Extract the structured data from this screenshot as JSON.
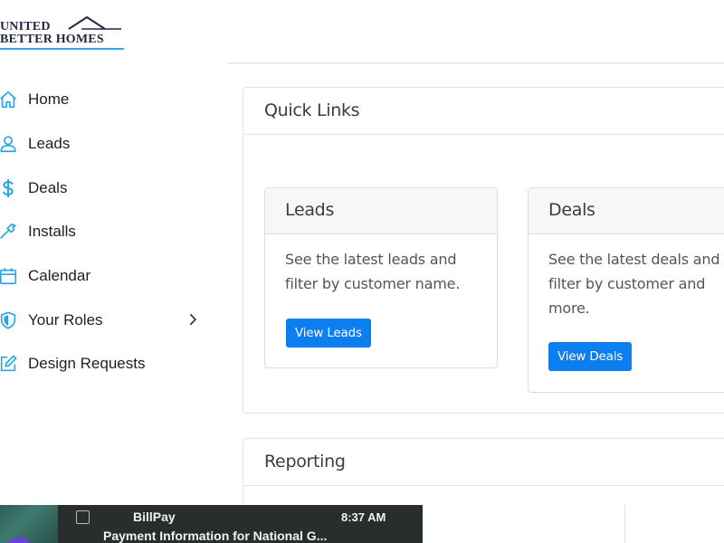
{
  "brand": {
    "line1": "UNITED",
    "line2": "BETTER HOMES",
    "accent_color": "#3aa3e0"
  },
  "sidebar": {
    "items": [
      {
        "label": "Home",
        "icon": "home-icon"
      },
      {
        "label": "Leads",
        "icon": "user-icon"
      },
      {
        "label": "Deals",
        "icon": "dollar-icon"
      },
      {
        "label": "Installs",
        "icon": "hammer-icon"
      },
      {
        "label": "Calendar",
        "icon": "calendar-icon"
      },
      {
        "label": "Your Roles",
        "icon": "shield-icon",
        "has_submenu": true
      },
      {
        "label": "Design Requests",
        "icon": "edit-icon"
      }
    ],
    "icon_color": "#2aa3e6"
  },
  "quick_links": {
    "title": "Quick Links",
    "cards": [
      {
        "title": "Leads",
        "description": "See the latest leads and filter by customer name.",
        "button": "View Leads"
      },
      {
        "title": "Deals",
        "description": "See the latest deals and filter by customer and more.",
        "button": "View Deals"
      }
    ]
  },
  "reporting": {
    "title": "Reporting"
  },
  "notification": {
    "sender": "BillPay",
    "time": "8:37 AM",
    "subject": "Payment Information for National G..."
  },
  "colors": {
    "primary_button": "#0d7ef0"
  }
}
